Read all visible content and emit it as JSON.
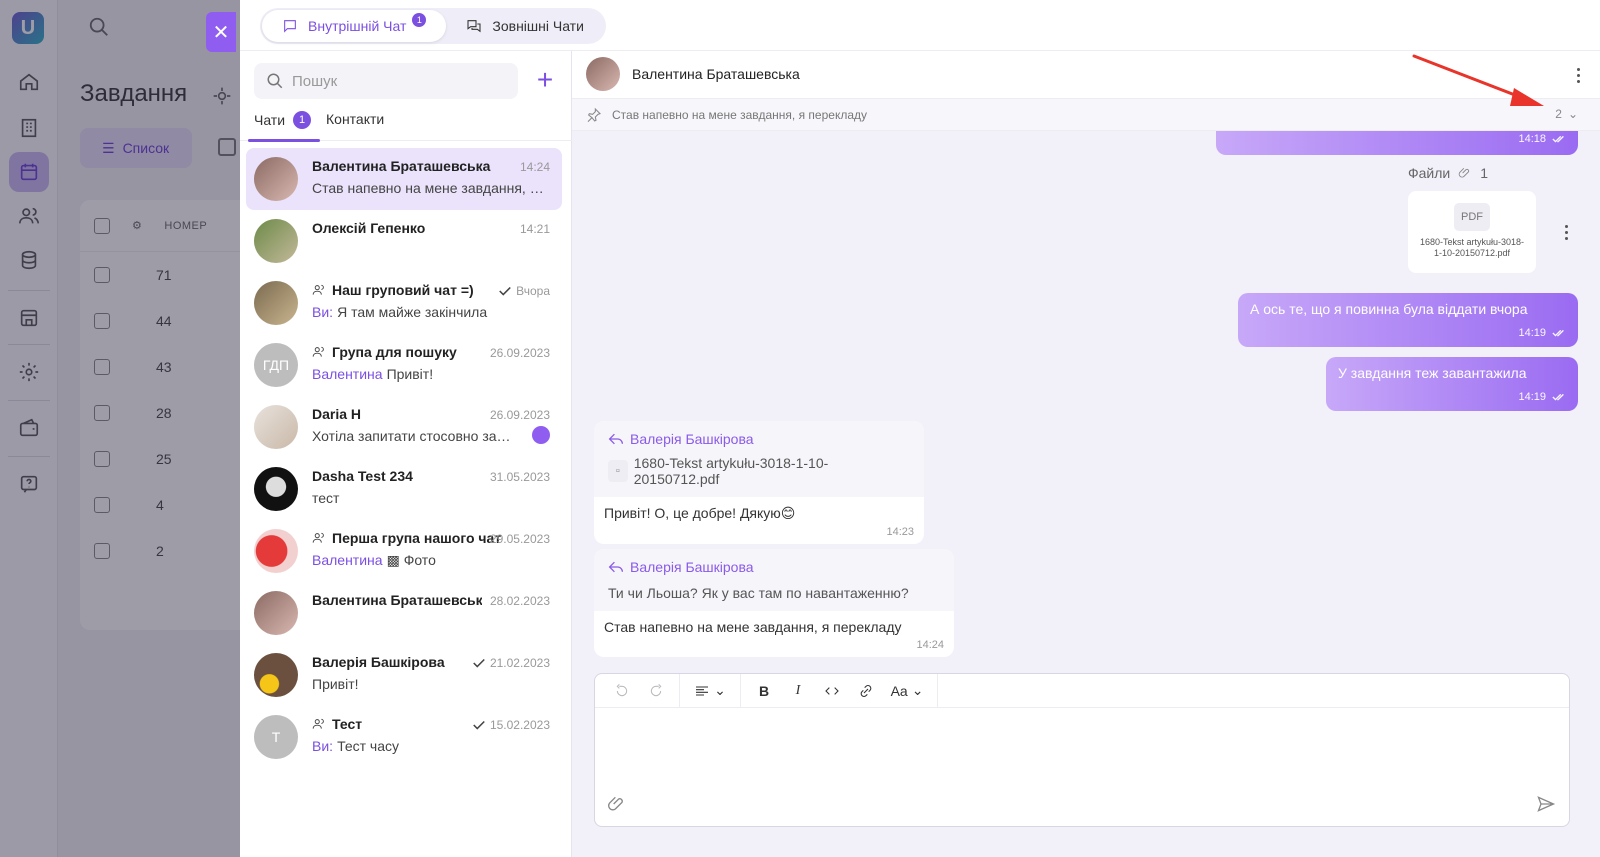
{
  "background": {
    "page_title": "Завдання",
    "list_button": "Список",
    "table_header": "НОМЕР",
    "rows": [
      "71",
      "44",
      "43",
      "28",
      "25",
      "4",
      "2"
    ]
  },
  "tabs": [
    {
      "label": "Внутрішній Чат",
      "badge": "1"
    },
    {
      "label": "Зовнішні Чати"
    }
  ],
  "search": {
    "placeholder": "Пошук"
  },
  "subtabs": {
    "chats": "Чати",
    "chats_badge": "1",
    "contacts": "Контакти"
  },
  "chats": [
    {
      "name": "Валентина Браташевська",
      "time": "14:24",
      "preview": "Став напевно на мене завдання, я перекладу"
    },
    {
      "name": "Олексій Гепенко",
      "time": "14:21",
      "preview": ""
    },
    {
      "name": "Наш груповий чат =)",
      "time": "Вчора",
      "who": "Ви:",
      "preview": "Я там майже закінчила"
    },
    {
      "name": "Група для пошуку",
      "time": "26.09.2023",
      "who": "Валентина",
      "preview": "Привіт!",
      "initials": "ГДП"
    },
    {
      "name": "Daria H",
      "time": "26.09.2023",
      "preview": "Хотіла запитати стосовно завдання"
    },
    {
      "name": "Dasha Test 234",
      "time": "31.05.2023",
      "preview": "тест"
    },
    {
      "name": "Перша група нашого чату",
      "time": "29.05.2023",
      "who": "Валентина",
      "preview": "Фото"
    },
    {
      "name": "Валентина Браташевська",
      "time": "28.02.2023",
      "preview": ""
    },
    {
      "name": "Валерія Башкірова",
      "time": "21.02.2023",
      "preview": "Привіт!"
    },
    {
      "name": "Тест",
      "time": "15.02.2023",
      "who": "Ви:",
      "preview": "Тест часу",
      "initials": "Т"
    }
  ],
  "conversation": {
    "name": "Валентина Браташевська",
    "pinned": "Став напевно на мене завдання, я перекладу",
    "pinned_count": "2",
    "first_time": "14:18",
    "files_label": "Файли",
    "files_count": "1",
    "file_type": "PDF",
    "file_name": "1680-Tekst artykułu-3018-1-10-20150712.pdf",
    "msg1": {
      "text": "А ось те, що я повинна була віддати вчора",
      "time": "14:19"
    },
    "msg2": {
      "text": "У завдання теж завантажила",
      "time": "14:19"
    },
    "reply1": {
      "author": "Валерія Башкірова",
      "file": "1680-Tekst artykułu-3018-1-10-20150712.pdf",
      "text": "Привіт! О, це добре! Дякую😊",
      "time": "14:23"
    },
    "reply2": {
      "author": "Валерія Башкірова",
      "quote": "Ти чи Льоша? Як у вас там по навантаженню?",
      "text": "Став напевно на мене завдання, я перекладу",
      "time": "14:24"
    }
  },
  "editor": {
    "font_button": "Aa"
  },
  "colors": {
    "accent": "#7b4fe0",
    "bubble_start": "#c7a8f8",
    "bubble_end": "#9a6bf2",
    "annotation_arrow": "#e8342a"
  }
}
